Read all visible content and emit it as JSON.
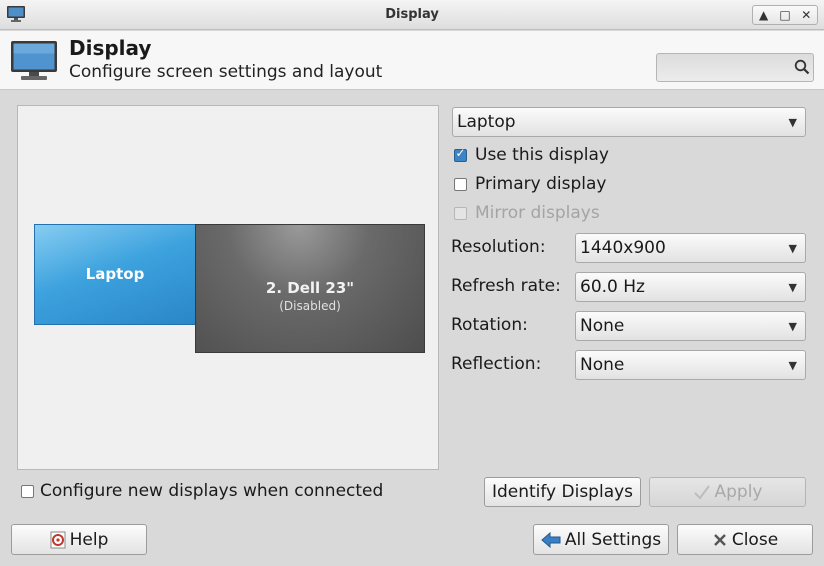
{
  "window": {
    "title": "Display"
  },
  "header": {
    "title": "Display",
    "subtitle": "Configure screen settings and layout",
    "search": {
      "value": ""
    }
  },
  "preview": {
    "monitors": [
      {
        "label": "Laptop"
      },
      {
        "label": "2. Dell 23\"",
        "status": "(Disabled)"
      }
    ]
  },
  "settings": {
    "display_select": "Laptop",
    "use_display": {
      "label": "Use this display",
      "checked": true
    },
    "primary_display": {
      "label": "Primary display",
      "checked": false
    },
    "mirror_displays": {
      "label": "Mirror displays",
      "checked": false,
      "enabled": false
    },
    "resolution": {
      "label": "Resolution:",
      "value": "1440x900"
    },
    "refresh_rate": {
      "label": "Refresh rate:",
      "value": "60.0 Hz"
    },
    "rotation": {
      "label": "Rotation:",
      "value": "None"
    },
    "reflection": {
      "label": "Reflection:",
      "value": "None"
    }
  },
  "configure_new": {
    "label": "Configure new displays when connected",
    "checked": false
  },
  "buttons": {
    "identify": "Identify Displays",
    "apply": "Apply",
    "help": "Help",
    "all_settings": "All Settings",
    "close": "Close"
  },
  "icons": {
    "app": "monitor-icon",
    "search": "search-icon",
    "help": "help-icon",
    "back": "back-arrow-icon",
    "close": "close-x-icon",
    "apply": "checkmark-icon"
  },
  "colors": {
    "laptop_monitor": "#3da2de",
    "disabled_monitor": "#5a5a5a",
    "checkbox_checked": "#3c84c4"
  }
}
